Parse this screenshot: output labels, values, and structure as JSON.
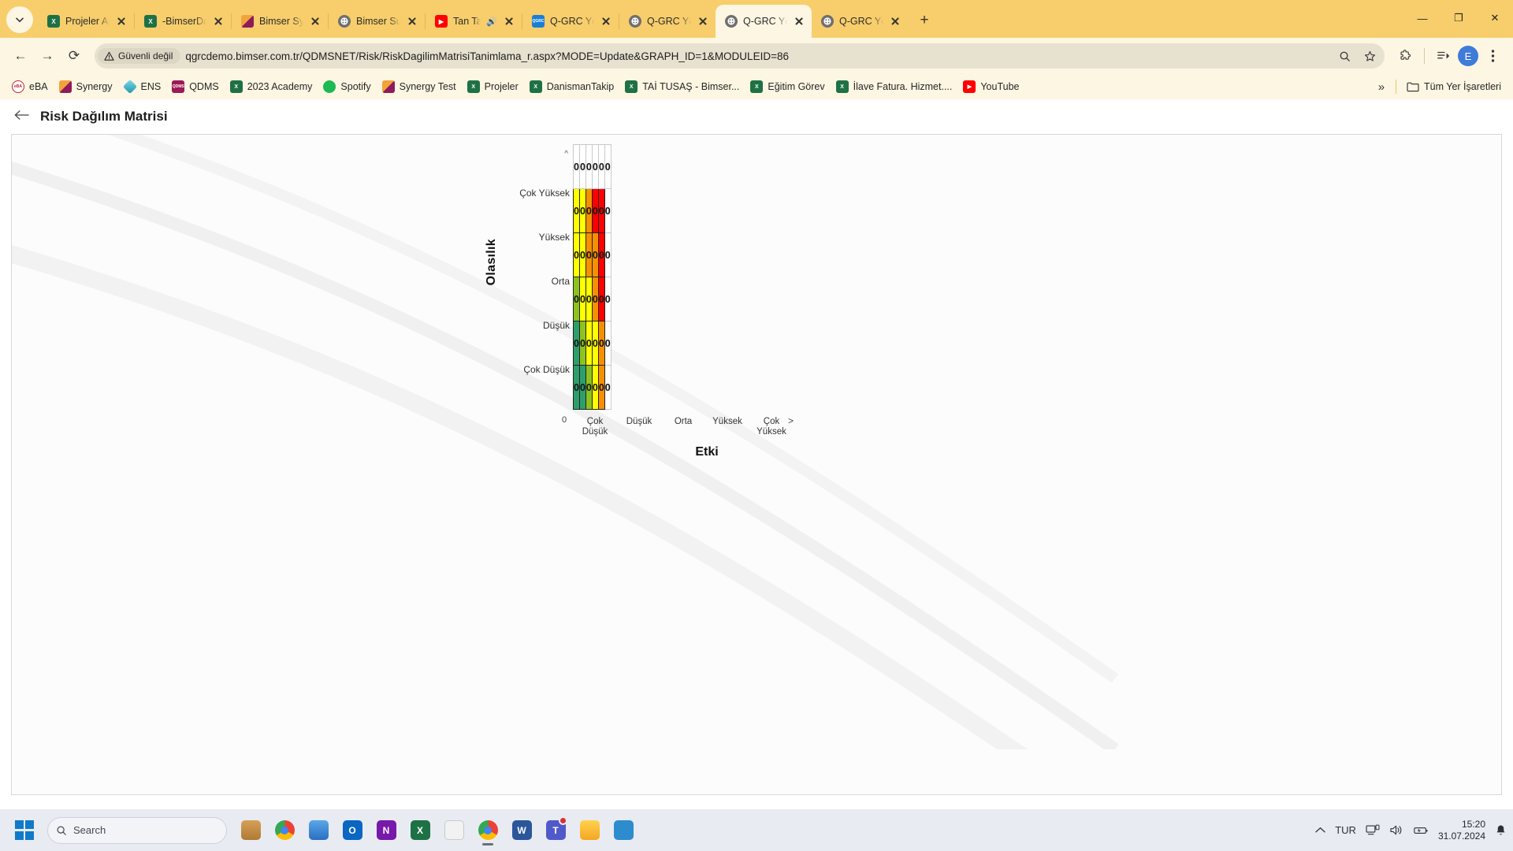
{
  "browser": {
    "tab_search_icon": "chevron-down-icon",
    "tabs": [
      {
        "title": "Projeler Appli",
        "favicon": "excel-icon",
        "fav_color": "#1e7145",
        "fav_text": "X",
        "active": false,
        "muted": false
      },
      {
        "title": "-BimserDanis",
        "favicon": "excel-icon",
        "fav_color": "#1e7145",
        "fav_text": "X",
        "active": false,
        "muted": false
      },
      {
        "title": "Bimser Synerg",
        "favicon": "synergy-icon",
        "fav_color": "#e8a33d",
        "fav_text": "",
        "active": false,
        "muted": false
      },
      {
        "title": "Bimser Suppo",
        "favicon": "globe-icon",
        "fav_color": "#6f6f6f",
        "fav_text": "",
        "active": false,
        "muted": false
      },
      {
        "title": "Tan Taşçı",
        "favicon": "youtube-icon",
        "fav_color": "#ff0000",
        "fav_text": "▶",
        "active": false,
        "muted": true
      },
      {
        "title": "Q-GRC Yöneti",
        "favicon": "qgrc-icon",
        "fav_color": "#1a7fd4",
        "fav_text": "QGRC",
        "active": false,
        "muted": false
      },
      {
        "title": "Q-GRC Yöneti",
        "favicon": "globe-icon",
        "fav_color": "#6f6f6f",
        "fav_text": "",
        "active": false,
        "muted": false
      },
      {
        "title": "Q-GRC Yöneti",
        "favicon": "globe-icon",
        "fav_color": "#6f6f6f",
        "fav_text": "",
        "active": true,
        "muted": false
      },
      {
        "title": "Q-GRC Yöneti",
        "favicon": "globe-icon",
        "fav_color": "#6f6f6f",
        "fav_text": "",
        "active": false,
        "muted": false
      }
    ],
    "new_tab_label": "+",
    "window_controls": {
      "minimize": "—",
      "maximize": "❐",
      "close": "✕"
    },
    "nav": {
      "back": "←",
      "forward": "→",
      "reload": "⟳"
    },
    "omnibox": {
      "security_label": "Güvenli değil",
      "security_icon": "warning-triangle-icon",
      "url": "qgrcdemo.bimser.com.tr/QDMSNET/Risk/RiskDagilimMatrisiTanimlama_r.aspx?MODE=Update&GRAPH_ID=1&MODULEID=86",
      "zoom_icon": "magnifier-icon",
      "bookmark_icon": "star-icon"
    },
    "toolbar_right": {
      "extensions_icon": "puzzle-icon",
      "reading_list_icon": "reading-list-icon",
      "profile_initial": "E",
      "menu_icon": "three-dots-icon"
    },
    "bookmarks": [
      {
        "label": "eBA",
        "icon": "eba-icon",
        "color": "#c8202c",
        "text": "eBA"
      },
      {
        "label": "Synergy",
        "icon": "synergy-icon",
        "color": "#e8a33d",
        "text": ""
      },
      {
        "label": "ENS",
        "icon": "ens-icon",
        "color": "#38b6c8",
        "text": ""
      },
      {
        "label": "QDMS",
        "icon": "qdms-icon",
        "color": "#9c1856",
        "text": "QDMS"
      },
      {
        "label": "2023 Academy",
        "icon": "excel-icon",
        "color": "#1e7145",
        "text": "X"
      },
      {
        "label": "Spotify",
        "icon": "spotify-icon",
        "color": "#1db954",
        "text": ""
      },
      {
        "label": "Synergy Test",
        "icon": "synergy-icon",
        "color": "#e8a33d",
        "text": ""
      },
      {
        "label": "Projeler",
        "icon": "excel-icon",
        "color": "#1e7145",
        "text": "X"
      },
      {
        "label": "DanismanTakip",
        "icon": "excel-icon",
        "color": "#1e7145",
        "text": "X"
      },
      {
        "label": "TAİ TUSAŞ - Bimser...",
        "icon": "excel-icon",
        "color": "#1e7145",
        "text": "X"
      },
      {
        "label": "Eğitim Görev",
        "icon": "excel-icon",
        "color": "#1e7145",
        "text": "X"
      },
      {
        "label": "İlave Fatura. Hizmet....",
        "icon": "excel-icon",
        "color": "#1e7145",
        "text": "X"
      },
      {
        "label": "YouTube",
        "icon": "youtube-icon",
        "color": "#ff0000",
        "text": "▶"
      }
    ],
    "bookmarks_overflow": "»",
    "all_bookmarks_label": "Tüm Yer İşaretleri",
    "all_bookmarks_icon": "folder-icon"
  },
  "page": {
    "back_icon": "arrow-left-icon",
    "title": "Risk Dağılım Matrisi"
  },
  "chart_data": {
    "type": "heatmap",
    "title": "Risk Dağılım Matrisi",
    "xlabel": "Etki",
    "ylabel": "Olasılık",
    "x_categories": [
      "Çok Düşük",
      "Düşük",
      "Orta",
      "Yüksek",
      "Çok Yüksek"
    ],
    "y_categories": [
      "Çok Yüksek",
      "Yüksek",
      "Orta",
      "Düşük",
      "Çok Düşük"
    ],
    "axis_origin_label": "0",
    "axis_overflow_label": ">",
    "axis_caret_label": "^",
    "grid": true,
    "legend": "none",
    "rows": [
      {
        "label": "",
        "cells": [
          {
            "value": "0",
            "color": "#ffffff"
          },
          {
            "value": "0",
            "color": "#ffffff"
          },
          {
            "value": "0",
            "color": "#ffffff"
          },
          {
            "value": "0",
            "color": "#ffffff"
          },
          {
            "value": "0",
            "color": "#ffffff"
          },
          {
            "value": "0",
            "color": "#ffffff"
          }
        ]
      },
      {
        "label": "Çok Yüksek",
        "cells": [
          {
            "value": "0",
            "color": "#ffff00"
          },
          {
            "value": "0",
            "color": "#ffff00"
          },
          {
            "value": "0",
            "color": "#f79000"
          },
          {
            "value": "0",
            "color": "#ff0000"
          },
          {
            "value": "0",
            "color": "#ff0000"
          },
          {
            "value": "0",
            "color": "#ffffff"
          }
        ]
      },
      {
        "label": "Yüksek",
        "cells": [
          {
            "value": "0",
            "color": "#ffff00"
          },
          {
            "value": "0",
            "color": "#ffff00"
          },
          {
            "value": "0",
            "color": "#f79000"
          },
          {
            "value": "0",
            "color": "#f79000"
          },
          {
            "value": "0",
            "color": "#ff0000"
          },
          {
            "value": "0",
            "color": "#ffffff"
          }
        ]
      },
      {
        "label": "Orta",
        "cells": [
          {
            "value": "0",
            "color": "#8dc21f"
          },
          {
            "value": "0",
            "color": "#ffff00"
          },
          {
            "value": "0",
            "color": "#ffff00"
          },
          {
            "value": "0",
            "color": "#f79000"
          },
          {
            "value": "0",
            "color": "#ff0000"
          },
          {
            "value": "0",
            "color": "#ffffff"
          }
        ]
      },
      {
        "label": "Düşük",
        "cells": [
          {
            "value": "0",
            "color": "#2e9e6b"
          },
          {
            "value": "0",
            "color": "#8dc21f"
          },
          {
            "value": "0",
            "color": "#ffff00"
          },
          {
            "value": "0",
            "color": "#ffff00"
          },
          {
            "value": "0",
            "color": "#f79000"
          },
          {
            "value": "0",
            "color": "#ffffff"
          }
        ]
      },
      {
        "label": "Çok Düşük",
        "cells": [
          {
            "value": "0",
            "color": "#2e9e6b"
          },
          {
            "value": "0",
            "color": "#2e9e6b"
          },
          {
            "value": "0",
            "color": "#8dc21f"
          },
          {
            "value": "0",
            "color": "#ffff00"
          },
          {
            "value": "0",
            "color": "#f79000"
          },
          {
            "value": "0",
            "color": "#ffffff"
          }
        ]
      }
    ]
  },
  "taskbar": {
    "start_icon": "windows-logo-icon",
    "search_placeholder": "Search",
    "search_icon": "magnifier-icon",
    "apps": [
      {
        "name": "widgets-icon",
        "color": "#c58b3b",
        "text": "",
        "active": false,
        "badge": false
      },
      {
        "name": "chrome-icon",
        "color": "#4caf50",
        "text": "",
        "active": false,
        "badge": false
      },
      {
        "name": "task-view-icon",
        "color": "#2b7fd6",
        "text": "",
        "active": false,
        "badge": false
      },
      {
        "name": "outlook-icon",
        "color": "#0a66c2",
        "text": "O",
        "active": false,
        "badge": false
      },
      {
        "name": "onenote-icon",
        "color": "#7719aa",
        "text": "N",
        "active": false,
        "badge": false
      },
      {
        "name": "excel-icon",
        "color": "#1e7145",
        "text": "X",
        "active": false,
        "badge": false
      },
      {
        "name": "notepad-icon",
        "color": "#f2f2f2",
        "text": "",
        "active": false,
        "badge": false
      },
      {
        "name": "chrome-icon",
        "color": "#4caf50",
        "text": "",
        "active": true,
        "badge": false
      },
      {
        "name": "word-icon",
        "color": "#2b579a",
        "text": "W",
        "active": false,
        "badge": false
      },
      {
        "name": "teams-icon",
        "color": "#5059c9",
        "text": "T",
        "active": false,
        "badge": true
      },
      {
        "name": "file-explorer-icon",
        "color": "#ffb900",
        "text": "",
        "active": false,
        "badge": false
      },
      {
        "name": "security-icon",
        "color": "#2d8ccd",
        "text": "",
        "active": false,
        "badge": false
      }
    ],
    "tray": {
      "overflow_icon": "chevron-up-icon",
      "language": "TUR",
      "network_icon": "network-icon",
      "volume_icon": "speaker-icon",
      "battery_icon": "battery-icon",
      "time": "15:20",
      "date": "31.07.2024",
      "notification_icon": "bell-icon"
    }
  }
}
